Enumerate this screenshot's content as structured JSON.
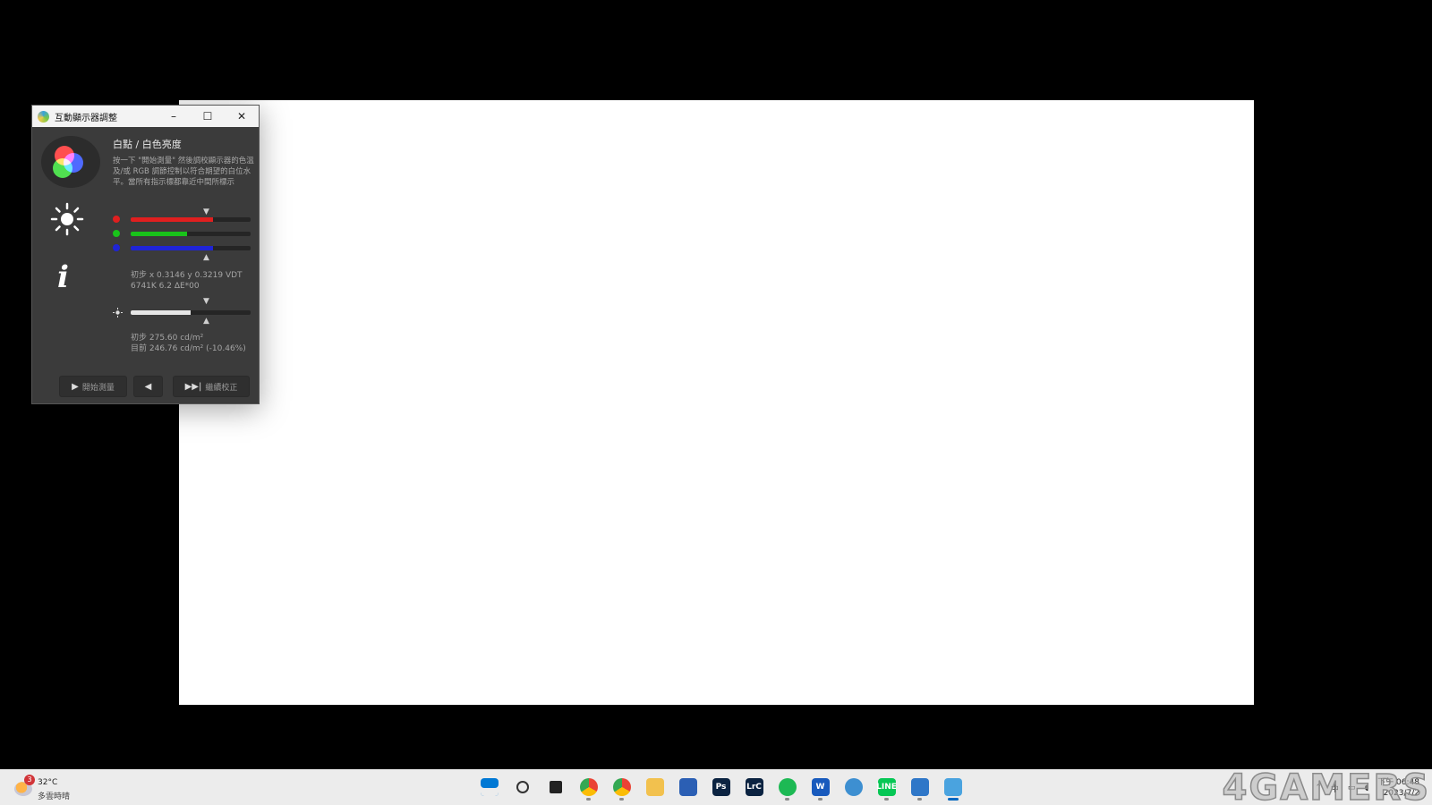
{
  "window": {
    "title": "互動顯示器調整",
    "controls": {
      "minimize": "–",
      "maximize": "☐",
      "close": "✕"
    }
  },
  "panel": {
    "heading": "白點 / 白色亮度",
    "instructions": "按一下 \"開始測量\" 然後調校顯示器的色溫及/或 RGB 調節控制以符合期望的白位水平。當所有指示標都靠近中間所標示",
    "sliders": {
      "red": {
        "color": "#e01f1f",
        "level": 0.69
      },
      "green": {
        "color": "#19c31a",
        "level": 0.47
      },
      "blue": {
        "color": "#1f24d6",
        "level": 0.69
      },
      "luminance": {
        "color": "#e6e6e6",
        "level": 0.5
      }
    },
    "marker_down": "▼",
    "marker_up": "▲",
    "white_readout_line1": "初步 x 0.3146 y 0.3219 VDT",
    "white_readout_line2": "6741K 6.2 ΔE*00",
    "lum_readout_line1": "初步 275.60 cd/m²",
    "lum_readout_line2": "目前 246.76 cd/m² (-10.46%)"
  },
  "buttons": {
    "start_label": "開始測量",
    "start_glyph": "▶",
    "back_glyph": "◀",
    "continue_label": "繼續校正",
    "continue_glyph": "▶▶|"
  },
  "taskbar": {
    "weather_temp": "32°C",
    "weather_cond": "多雲時晴",
    "weather_badge": "3",
    "apps": [
      {
        "name": "start",
        "label": "",
        "color": "#0078d4"
      },
      {
        "name": "search",
        "label": "",
        "color": ""
      },
      {
        "name": "task-view",
        "label": "",
        "color": ""
      },
      {
        "name": "chrome",
        "label": "",
        "color": ""
      },
      {
        "name": "chrome-dev",
        "label": "",
        "color": ""
      },
      {
        "name": "file-explorer",
        "label": "",
        "color": "#f2c14e"
      },
      {
        "name": "store",
        "label": "",
        "color": "#2b5fb4"
      },
      {
        "name": "photoshop",
        "label": "Ps",
        "color": "#0b2341"
      },
      {
        "name": "lightroom",
        "label": "LrC",
        "color": "#0b2341"
      },
      {
        "name": "spotify",
        "label": "",
        "color": "#1db954"
      },
      {
        "name": "word",
        "label": "W",
        "color": "#185abd"
      },
      {
        "name": "network-app",
        "label": "",
        "color": "#3d8fd1"
      },
      {
        "name": "line",
        "label": "LINE",
        "color": "#06c755"
      },
      {
        "name": "displaycal",
        "label": "",
        "color": "#2f77c8"
      },
      {
        "name": "calibration",
        "label": "",
        "color": "#4aa3df"
      }
    ],
    "tray_ime": "中",
    "clock_time": "下午 06:48",
    "clock_date": "2023/7/2"
  },
  "watermark": "4GAMERS"
}
